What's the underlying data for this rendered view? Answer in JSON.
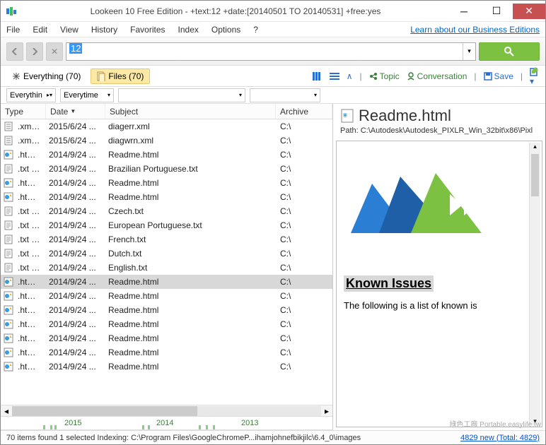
{
  "window": {
    "title": "Lookeen 10 Free Edition - +text:12 +date:[20140501 TO 20140531] +free:yes"
  },
  "menu": {
    "items": [
      "File",
      "Edit",
      "View",
      "History",
      "Favorites",
      "Index",
      "Options",
      "?"
    ],
    "right_link": "Learn about our Business Editions"
  },
  "search": {
    "value": "12"
  },
  "filter_tabs": {
    "everything": "Everything (70)",
    "files": "Files (70)"
  },
  "actions": {
    "topic": "Topic",
    "conversation": "Conversation",
    "save": "Save"
  },
  "col_filters": {
    "a": "Everythin",
    "b": "Everytime"
  },
  "columns": {
    "type": "Type",
    "date": "Date",
    "subject": "Subject",
    "archive": "Archive"
  },
  "rows": [
    {
      "icon": "xml",
      "type": ".xml File",
      "date": "2015/6/24 ...",
      "subject": "diagerr.xml",
      "archive": "C:\\"
    },
    {
      "icon": "xml",
      "type": ".xml File",
      "date": "2015/6/24 ...",
      "subject": "diagwrn.xml",
      "archive": "C:\\"
    },
    {
      "icon": "html",
      "type": ".html ...",
      "date": "2014/9/24 ...",
      "subject": "Readme.html",
      "archive": "C:\\"
    },
    {
      "icon": "txt",
      "type": ".txt File",
      "date": "2014/9/24 ...",
      "subject": "Brazilian Portuguese.txt",
      "archive": "C:\\"
    },
    {
      "icon": "html",
      "type": ".html ...",
      "date": "2014/9/24 ...",
      "subject": "Readme.html",
      "archive": "C:\\"
    },
    {
      "icon": "html",
      "type": ".html ...",
      "date": "2014/9/24 ...",
      "subject": "Readme.html",
      "archive": "C:\\"
    },
    {
      "icon": "txt",
      "type": ".txt File",
      "date": "2014/9/24 ...",
      "subject": "Czech.txt",
      "archive": "C:\\"
    },
    {
      "icon": "txt",
      "type": ".txt File",
      "date": "2014/9/24 ...",
      "subject": "European Portuguese.txt",
      "archive": "C:\\"
    },
    {
      "icon": "txt",
      "type": ".txt File",
      "date": "2014/9/24 ...",
      "subject": "French.txt",
      "archive": "C:\\"
    },
    {
      "icon": "txt",
      "type": ".txt File",
      "date": "2014/9/24 ...",
      "subject": "Dutch.txt",
      "archive": "C:\\"
    },
    {
      "icon": "txt",
      "type": ".txt File",
      "date": "2014/9/24 ...",
      "subject": "English.txt",
      "archive": "C:\\"
    },
    {
      "icon": "html",
      "type": ".html ...",
      "date": "2014/9/24 ...",
      "subject": "Readme.html",
      "archive": "C:\\",
      "selected": true
    },
    {
      "icon": "html",
      "type": ".html ...",
      "date": "2014/9/24 ...",
      "subject": "Readme.html",
      "archive": "C:\\"
    },
    {
      "icon": "html",
      "type": ".html ...",
      "date": "2014/9/24 ...",
      "subject": "Readme.html",
      "archive": "C:\\"
    },
    {
      "icon": "html",
      "type": ".html ...",
      "date": "2014/9/24 ...",
      "subject": "Readme.html",
      "archive": "C:\\"
    },
    {
      "icon": "html",
      "type": ".html ...",
      "date": "2014/9/24 ...",
      "subject": "Readme.html",
      "archive": "C:\\"
    },
    {
      "icon": "html",
      "type": ".html ...",
      "date": "2014/9/24 ...",
      "subject": "Readme.html",
      "archive": "C:\\"
    },
    {
      "icon": "html",
      "type": ".html ...",
      "date": "2014/9/24 ...",
      "subject": "Readme.html",
      "archive": "C:\\"
    }
  ],
  "timeline": {
    "years": [
      "2015",
      "2014",
      "2013"
    ]
  },
  "preview": {
    "title": "Readme.html",
    "path": "Path: C:\\Autodesk\\Autodesk_PIXLR_Win_32bit\\x86\\Pixl",
    "heading": "Known Issues",
    "body": "The following is a list of known is"
  },
  "status": {
    "left": "70 items found  1 selected  Indexing: C:\\Program Files\\GoogleChromeP...ihamjohnefbikjilc\\6.4_0\\images",
    "right": "4829 new (Total: 4829)"
  },
  "watermark": "綠色工廠 Portable.easylife.tw"
}
